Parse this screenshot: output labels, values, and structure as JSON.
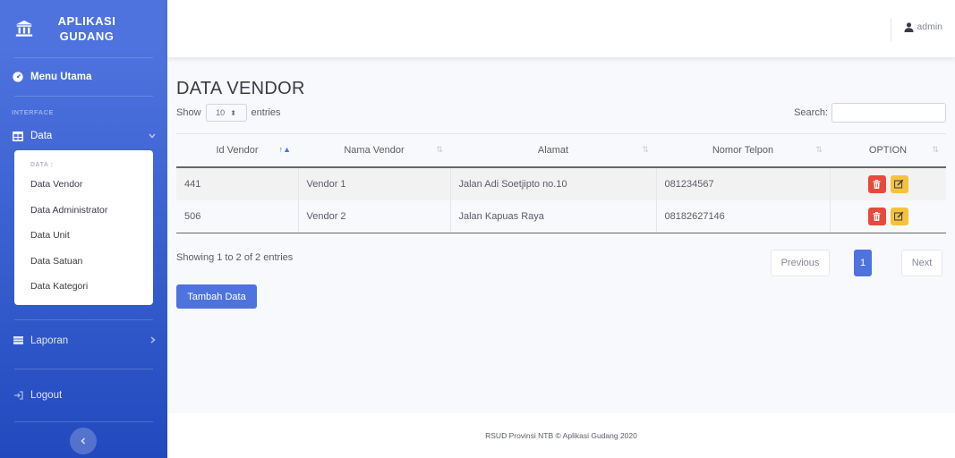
{
  "sidebar": {
    "brand_line1": "APLIKASI",
    "brand_line2": "GUDANG",
    "menu_utama": "Menu Utama",
    "heading_interface": "INTERFACE",
    "data_label": "Data",
    "submenu_heading": "DATA :",
    "submenu_items": [
      "Data Vendor",
      "Data Administrator",
      "Data Unit",
      "Data Satuan",
      "Data Kategori"
    ],
    "laporan_label": "Laporan",
    "logout_label": "Logout",
    "toggle_icon": "chevron-left-icon"
  },
  "topbar": {
    "user_name": "admin",
    "user_icon": "user-icon"
  },
  "main": {
    "title": "DATA VENDOR",
    "show_label": "Show",
    "entries_value": "10",
    "entries_label": "entries",
    "search_label": "Search:",
    "table": {
      "headers": [
        "Id Vendor",
        "Nama Vendor",
        "Alamat",
        "Nomor Telpon",
        "OPTION"
      ],
      "rows": [
        [
          "441",
          "Vendor 1",
          "Jalan Adi Soetjipto no.10",
          "081234567"
        ],
        [
          "506",
          "Vendor 2",
          "Jalan Kapuas Raya",
          "08182627146"
        ]
      ]
    },
    "showing_text": "Showing 1 to 2 of 2 entries",
    "pager": {
      "previous": "Previous",
      "page": "1",
      "next": "Next"
    },
    "add_button": "Tambah Data"
  },
  "footer": {
    "text": "RSUD Provinsi NTB © Aplikasi Gudang 2020"
  },
  "colors": {
    "primary": "#4e73df",
    "danger": "#e74a3b",
    "warning": "#f6c23e"
  }
}
